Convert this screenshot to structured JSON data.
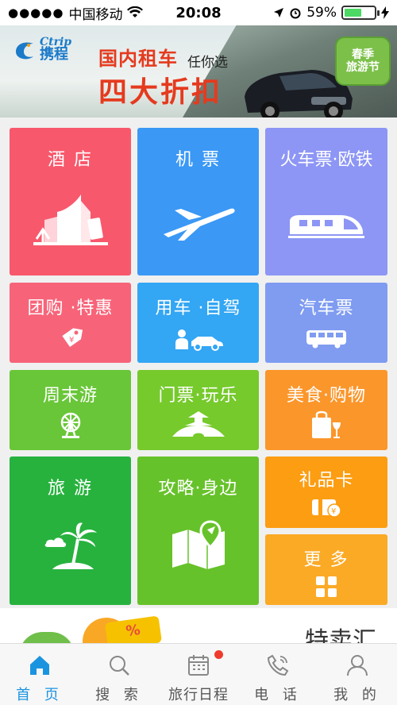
{
  "status_bar": {
    "signal": "●●●●●",
    "carrier": "中国移动",
    "time": "20:08",
    "battery_percent": "59%",
    "battery_level": 0.59
  },
  "banner": {
    "brand_en": "Ctrip",
    "brand_cn": "携程",
    "headline": "国内租车",
    "headline_suffix": "任你选",
    "offer": "四大折扣",
    "badge_line1": "春季",
    "badge_line2": "旅游节"
  },
  "tiles": {
    "hotel": "酒 店",
    "flight": "机 票",
    "train": "火车票·欧铁",
    "group": "团购 ·特惠",
    "car": "用车 ·自驾",
    "bus": "汽车票",
    "weekend": "周末游",
    "tickets": "门票·玩乐",
    "food": "美食·购物",
    "travel": "旅 游",
    "guide": "攻略·身边",
    "giftcard": "礼品卡",
    "more": "更 多"
  },
  "teaser": {
    "tag": "%",
    "title": "特卖汇"
  },
  "tabbar": {
    "home": "首 页",
    "search": "搜 索",
    "itinerary": "旅行日程",
    "phone": "电 话",
    "mine": "我 的"
  },
  "colors": {
    "hotel": "#f8586c",
    "flight": "#3b98f5",
    "train": "#8d96f5",
    "group": "#f76479",
    "car": "#33a6f4",
    "bus": "#7f9cf1",
    "weekend": "#69c638",
    "tickets": "#76ca2c",
    "food": "#fb962b",
    "travel": "#27b23e",
    "guide": "#66c22a",
    "giftcard": "#fc9d12",
    "more": "#fbaa26",
    "accent": "#1b94e0"
  }
}
